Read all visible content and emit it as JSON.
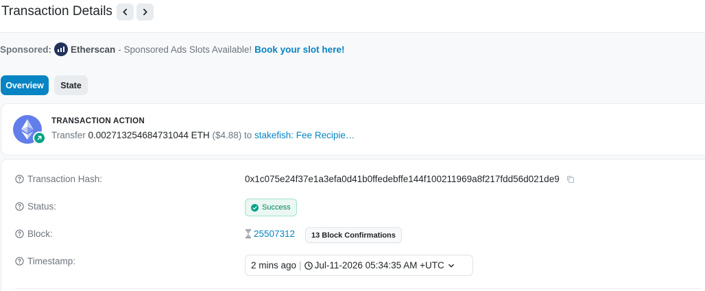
{
  "header": {
    "title": "Transaction Details"
  },
  "sponsored": {
    "label": "Sponsored:",
    "brand": "Etherscan",
    "text": "- Sponsored Ads Slots Available!",
    "link": "Book your slot here!"
  },
  "tabs": [
    {
      "label": "Overview",
      "active": true
    },
    {
      "label": "State",
      "active": false
    }
  ],
  "action": {
    "title": "TRANSACTION ACTION",
    "verb": "Transfer",
    "amount": "0.002713254684731044 ETH",
    "usd": "($4.88)",
    "to": "to",
    "recipient": "stakefish: Fee Recipie…"
  },
  "details": {
    "hash_label": "Transaction Hash:",
    "hash_value": "0x1c075e24f37e1a3efa0d41b0ffedebffe144f100211969a8f217fdd56d021de9",
    "status_label": "Status:",
    "status_value": "Success",
    "block_label": "Block:",
    "block_value": "25507312",
    "confirmations": "13 Block Confirmations",
    "timestamp_label": "Timestamp:",
    "timestamp_relative": "2 mins ago",
    "timestamp_separator": "|",
    "timestamp_value": "Jul-11-2026 05:34:35 AM +UTC"
  },
  "colors": {
    "accent": "#0784c3",
    "success": "#00a186"
  }
}
